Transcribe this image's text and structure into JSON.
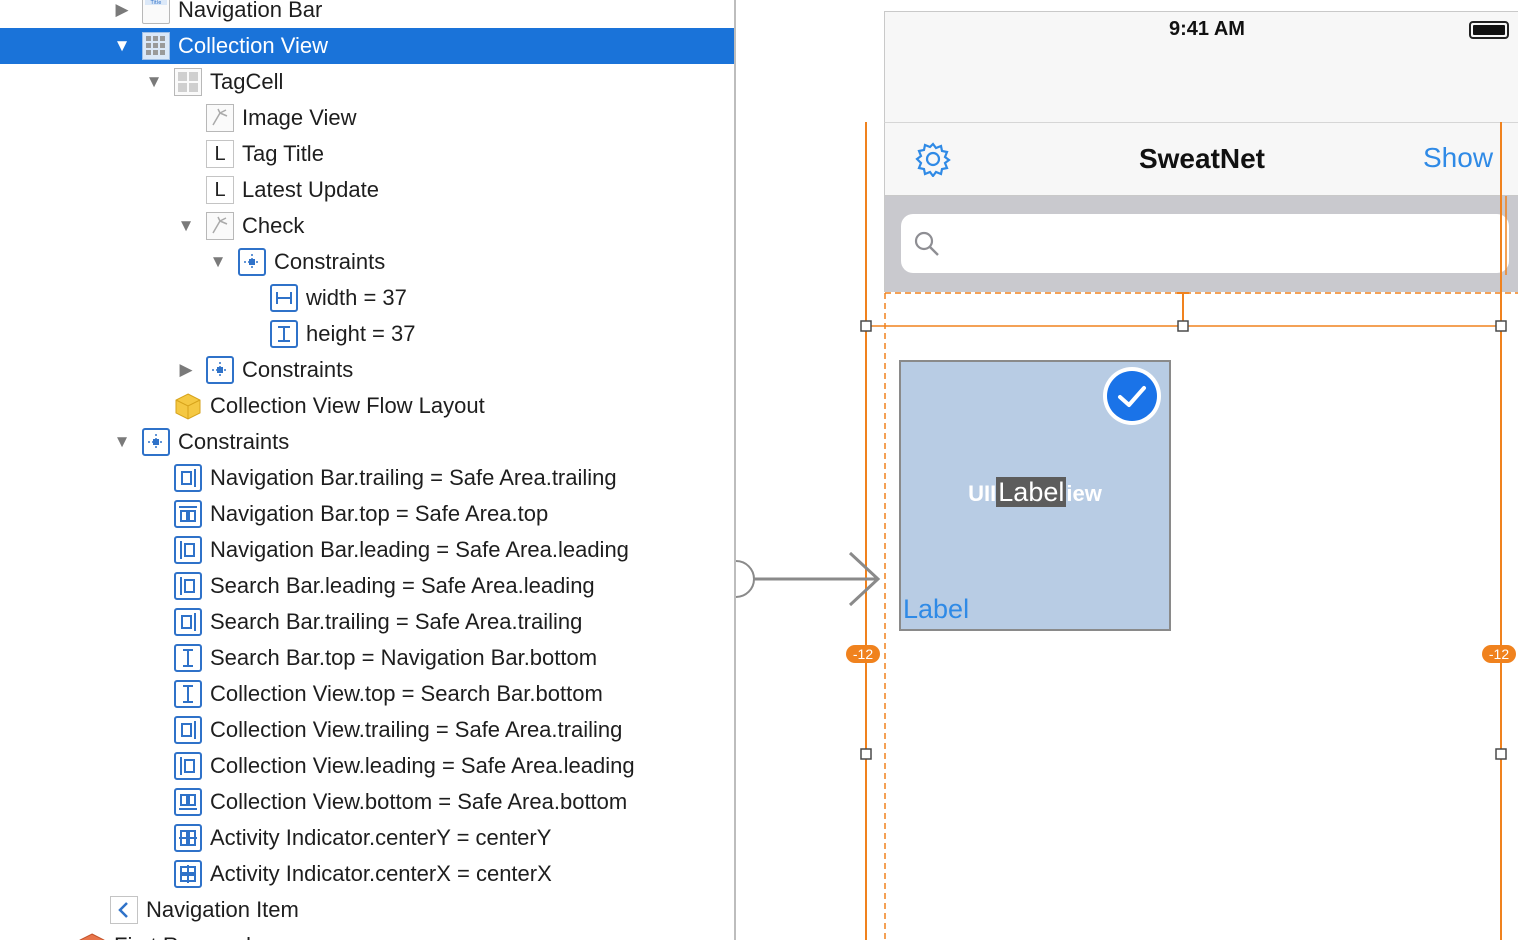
{
  "outline": {
    "rows": [
      {
        "label": "Navigation Bar",
        "icon": "navigation-bar-icon"
      },
      {
        "label": "Collection View",
        "icon": "collection-view-icon"
      },
      {
        "label": "TagCell",
        "icon": "collection-cell-icon"
      },
      {
        "label": "Image View",
        "icon": "image-view-icon"
      },
      {
        "label": "Tag Title",
        "icon": "label-icon",
        "glyph": "L"
      },
      {
        "label": "Latest Update",
        "icon": "label-icon",
        "glyph": "L"
      },
      {
        "label": "Check",
        "icon": "image-view-icon"
      },
      {
        "label": "Constraints",
        "icon": "constraints-icon"
      },
      {
        "label": "width = 37",
        "icon": "width-constraint-icon"
      },
      {
        "label": "height = 37",
        "icon": "height-constraint-icon"
      },
      {
        "label": "Constraints",
        "icon": "constraints-icon"
      },
      {
        "label": "Collection View Flow Layout",
        "icon": "flow-layout-cube-icon"
      },
      {
        "label": "Constraints",
        "icon": "constraints-icon"
      },
      {
        "label": "Navigation Bar.trailing = Safe Area.trailing",
        "icon": "trailing-constraint-icon"
      },
      {
        "label": "Navigation Bar.top = Safe Area.top",
        "icon": "top-constraint-icon"
      },
      {
        "label": "Navigation Bar.leading = Safe Area.leading",
        "icon": "leading-constraint-icon"
      },
      {
        "label": "Search Bar.leading = Safe Area.leading",
        "icon": "leading-constraint-icon"
      },
      {
        "label": "Search Bar.trailing = Safe Area.trailing",
        "icon": "trailing-constraint-icon"
      },
      {
        "label": "Search Bar.top = Navigation Bar.bottom",
        "icon": "vertical-spacing-constraint-icon"
      },
      {
        "label": "Collection View.top = Search Bar.bottom",
        "icon": "vertical-spacing-constraint-icon"
      },
      {
        "label": "Collection View.trailing = Safe Area.trailing",
        "icon": "trailing-constraint-icon"
      },
      {
        "label": "Collection View.leading = Safe Area.leading",
        "icon": "leading-constraint-icon"
      },
      {
        "label": "Collection View.bottom = Safe Area.bottom",
        "icon": "bottom-constraint-icon"
      },
      {
        "label": "Activity Indicator.centerY = centerY",
        "icon": "center-y-constraint-icon"
      },
      {
        "label": "Activity Indicator.centerX = centerX",
        "icon": "center-x-constraint-icon"
      },
      {
        "label": "Navigation Item",
        "icon": "navigation-item-icon"
      },
      {
        "label": "First Responder",
        "icon": "first-responder-icon"
      }
    ],
    "selected": "Collection View"
  },
  "canvas": {
    "status_time": "9:41 AM",
    "nav_title": "SweatNet",
    "nav_right_button": "Show",
    "cell_center_label_left": "UII",
    "cell_center_label": "Label",
    "cell_center_label_right": "iew",
    "cell_bottom_label": "Label",
    "margin_badge_left": "-12",
    "margin_badge_right": "-12"
  },
  "colors": {
    "selection": "#1a73d9",
    "constraint_orange": "#f0821e",
    "ios_blue": "#2f8ae6",
    "cell_fill": "#b8cce4"
  }
}
